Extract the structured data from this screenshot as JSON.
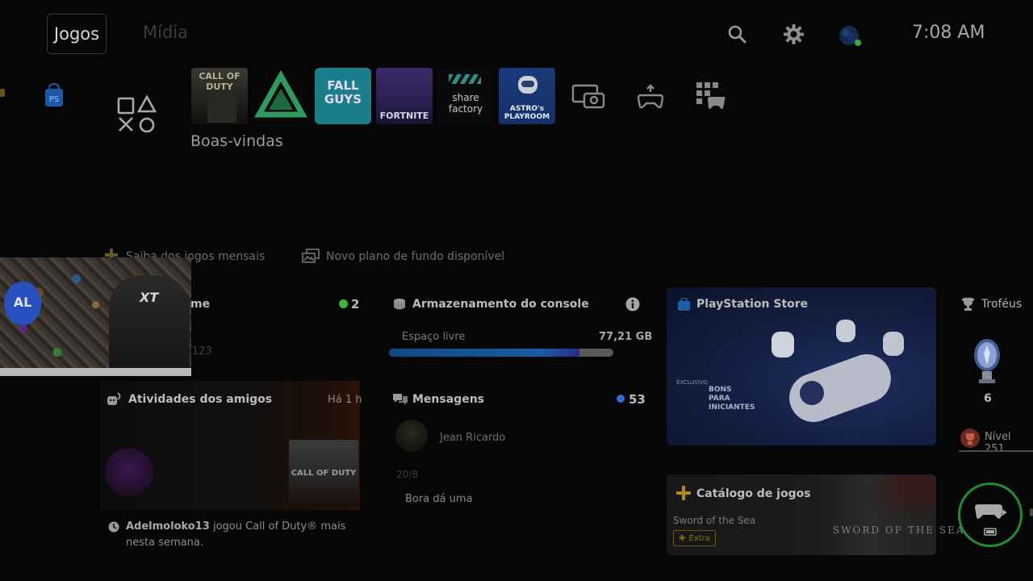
{
  "header": {
    "tab_games": "Jogos",
    "tab_media": "Mídia",
    "time": "7:08 AM"
  },
  "games_row": {
    "tiles": [
      {
        "label": "CALL OF DUTY"
      },
      {
        "label": ""
      },
      {
        "label": "FALL GUYS"
      },
      {
        "label": "FORTNITE"
      },
      {
        "label": "share factory"
      },
      {
        "label": "ASTRO's PLAYROOM"
      }
    ],
    "selected_title": "Boas-vindas"
  },
  "notifications": {
    "monthly_games": "Saiba dos jogos mensais",
    "new_wallpaper": "Novo plano de fundo disponível"
  },
  "online_card": {
    "title_partial": "me",
    "count": "2",
    "id_partial": "123"
  },
  "storage": {
    "title": "Armazenamento do console",
    "free_label": "Espaço livre",
    "free_value": "77,21 GB",
    "used_fraction": 0.85
  },
  "store": {
    "title": "PlayStation Store",
    "promo_tag": "BONS PARA INICIANTES",
    "promo_badge": "EXCLUSIVO"
  },
  "trophies": {
    "title": "Troféus",
    "platinum_count": "6",
    "level": "Nível 251"
  },
  "friends": {
    "title": "Atividades dos amigos",
    "time_ago": "Há 1 h",
    "game_art_label": "CALL OF DUTY",
    "user": "Adelmoloko13",
    "activity_text": "jogou Call of Duty® mais nesta semana."
  },
  "messages": {
    "title": "Mensagens",
    "count": "53",
    "sender": "Jean Ricardo",
    "date": "20/8",
    "preview": "Bora dá uma"
  },
  "catalog": {
    "title": "Catálogo de jogos",
    "game": "Sword of the Sea",
    "badge": "Extra",
    "logo_text": "SWORD OF THE SEA"
  },
  "webcam": {
    "chair_logo": "XT",
    "balloon_text": "AL"
  },
  "colors": {
    "online_green": "#3fb23f",
    "message_blue": "#2d6fd6",
    "plus_yellow": "#e7b416",
    "controller_ring": "#1f8f2f",
    "storage_fill": "#1a5ca0"
  }
}
